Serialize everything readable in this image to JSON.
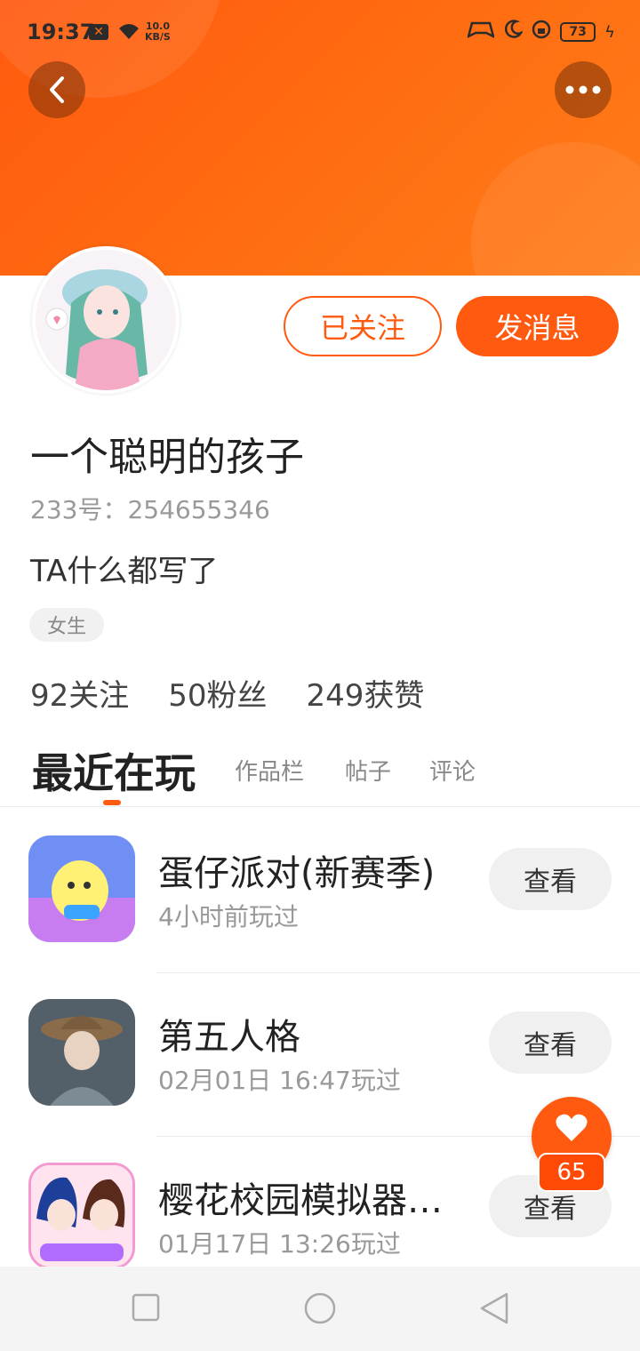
{
  "status_bar": {
    "time": "19:37",
    "notification_badge": "✕",
    "network_speed_value": "10.0",
    "network_speed_unit": "KB/S",
    "battery": "73"
  },
  "profile": {
    "follow_button_label": "已关注",
    "message_button_label": "发消息",
    "username": "一个聪明的孩子",
    "user_id_label": "233号：",
    "user_id": "254655346",
    "bio": "TA什么都写了",
    "gender_tag": "女生",
    "stats": [
      {
        "value": "92",
        "label": "关注"
      },
      {
        "value": "50",
        "label": "粉丝"
      },
      {
        "value": "249",
        "label": "获赞"
      }
    ]
  },
  "tabs": [
    {
      "label": "最近在玩",
      "active": true
    },
    {
      "label": "作品栏",
      "active": false
    },
    {
      "label": "帖子",
      "active": false
    },
    {
      "label": "评论",
      "active": false
    }
  ],
  "games": [
    {
      "title": "蛋仔派对(新赛季)",
      "time": "4小时前玩过",
      "action": "查看",
      "icon": "eggy-party-icon"
    },
    {
      "title": "第五人格",
      "time": "02月01日 16:47玩过",
      "action": "查看",
      "icon": "identity-v-icon"
    },
    {
      "title": "樱花校园模拟器…",
      "time": "01月17日 13:26玩过",
      "action": "查看",
      "icon": "sakura-school-icon"
    }
  ],
  "like_fab": {
    "count": "65"
  },
  "colors": {
    "accent": "#ff5a0f",
    "header_gradient_start": "#ff5a0f",
    "header_gradient_end": "#ff7d1a"
  }
}
